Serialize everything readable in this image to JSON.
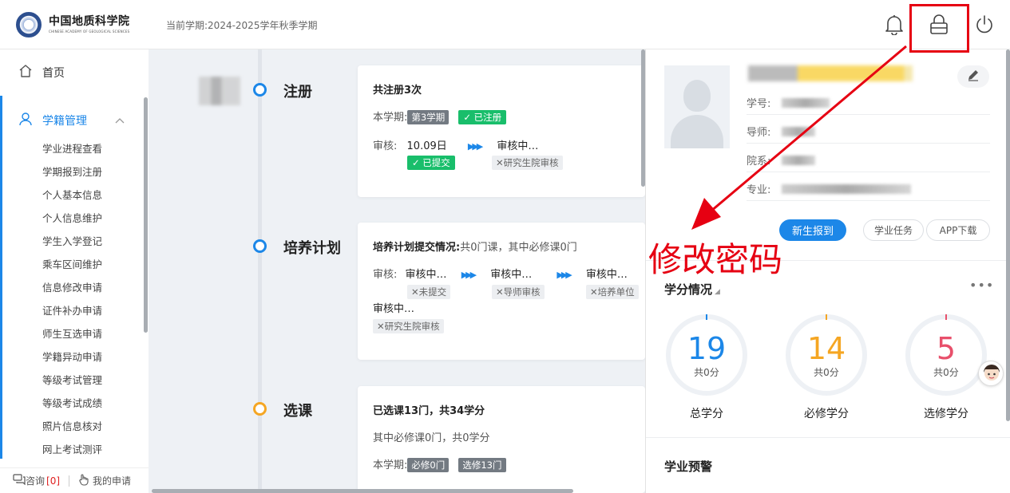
{
  "header": {
    "university_cn": "中国地质科学院",
    "university_en": "CHINESE ACADEMY OF GEOLOGICAL SCIENCES",
    "semester_text": "当前学期:2024-2025学年秋季学期",
    "icons": [
      "bell-icon",
      "lock-icon",
      "power-icon"
    ]
  },
  "sidebar": {
    "home_label": "首页",
    "group_label": "学籍管理",
    "items": [
      "学业进程查看",
      "学期报到注册",
      "个人基本信息",
      "个人信息维护",
      "学生入学登记",
      "乘车区间维护",
      "信息修改申请",
      "证件补办申请",
      "师生互选申请",
      "学籍异动申请",
      "等级考试管理",
      "等级考试成绩",
      "照片信息核对",
      "网上考试测评"
    ],
    "footer": {
      "consult_label": "咨询",
      "consult_count": "[0]",
      "my_apply_label": "我的申请"
    }
  },
  "timeline": {
    "register": {
      "title": "注册",
      "summary": "共注册3次",
      "current_label": "本学期:",
      "current_term_tag": "第3学期",
      "status_tag": "已注册",
      "review_label": "审核:",
      "review_date": "10.09日",
      "review_step2": "审核中…",
      "submitted_tag": "已提交",
      "step2_tag": "研究生院审核"
    },
    "plan": {
      "title": "培养计划",
      "summary_label": "培养计划提交情况:",
      "summary_value": "共0门课，其中必修课0门",
      "review_label": "审核:",
      "step1": "审核中…",
      "step2": "审核中…",
      "step3": "审核中…",
      "step4": "审核中…",
      "tag1": "未提交",
      "tag2": "导师审核",
      "tag3": "培养单位",
      "tag4": "研究生院审核"
    },
    "course": {
      "title": "选课",
      "summary": "已选课13门，共34学分",
      "line2": "其中必修课0门，共0学分",
      "current_label": "本学期:",
      "tag_required": "必修0门",
      "tag_elective": "选修13门"
    }
  },
  "profile": {
    "student_id_label": "学号:",
    "advisor_label": "导师:",
    "department_label": "院系:",
    "major_label": "专业:",
    "btn_new_student": "新生报到",
    "btn_tasks": "学业任务",
    "btn_app": "APP下载"
  },
  "credits": {
    "title": "学分情况",
    "more": "•••",
    "total": {
      "value": "19",
      "sub": "共0分",
      "label": "总学分",
      "color": "#1c87e8"
    },
    "required": {
      "value": "14",
      "sub": "共0分",
      "label": "必修学分",
      "color": "#f5a623"
    },
    "elective": {
      "value": "5",
      "sub": "共0分",
      "label": "选修学分",
      "color": "#e8506b"
    }
  },
  "warning": {
    "title": "学业预警"
  },
  "annotation": {
    "text": "修改密码",
    "color": "#e60012"
  }
}
